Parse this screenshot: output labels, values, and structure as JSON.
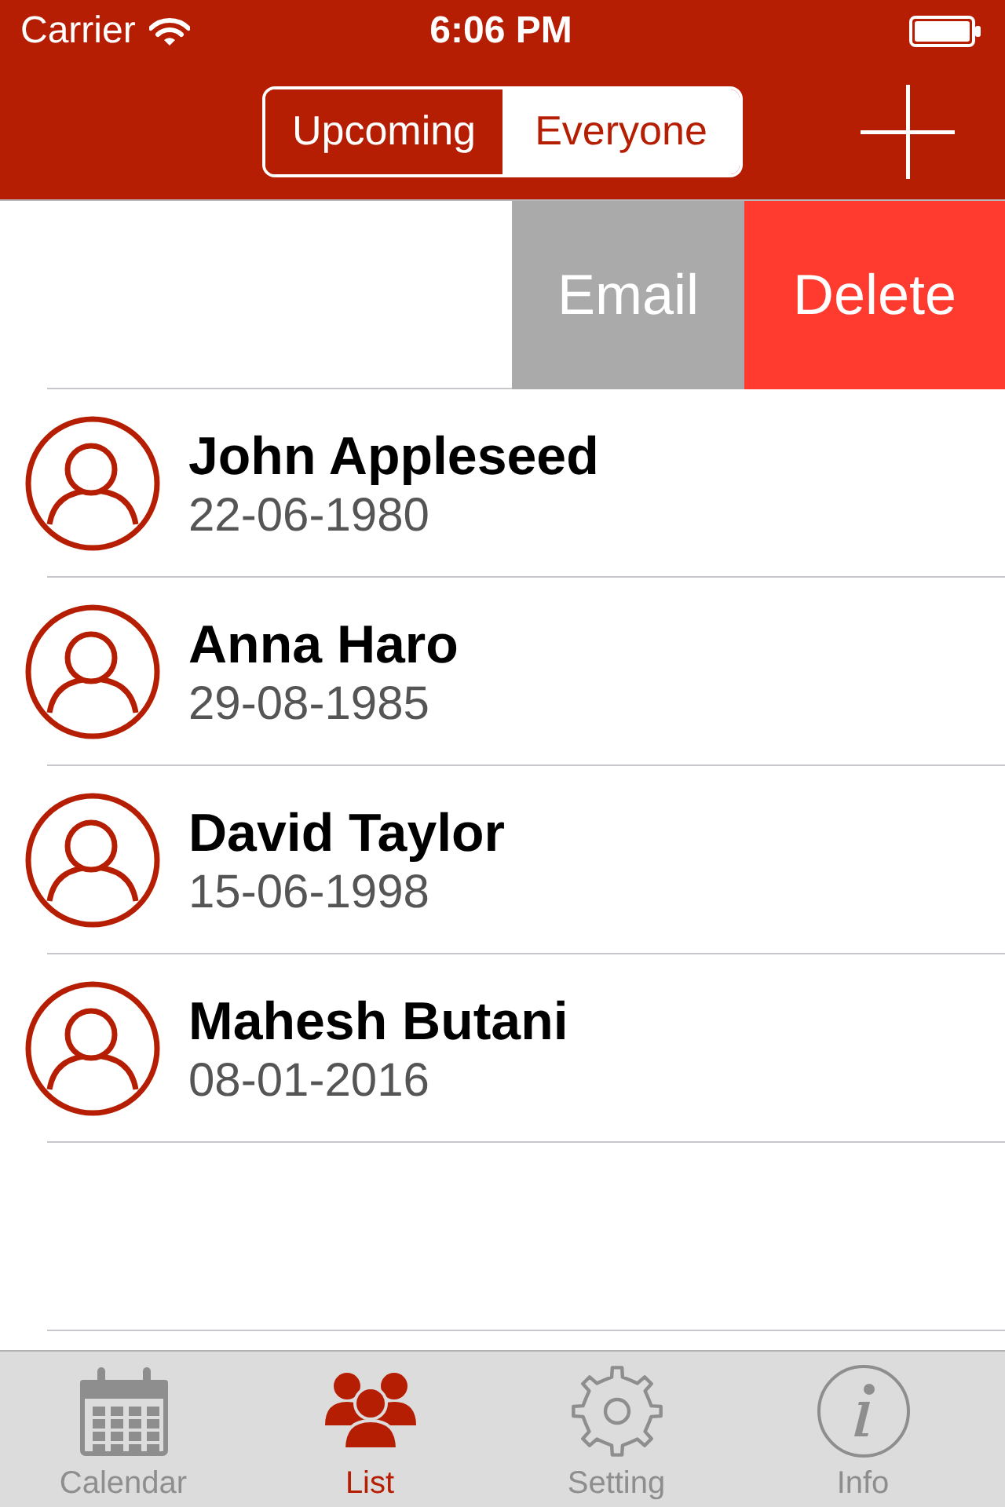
{
  "status_bar": {
    "carrier": "Carrier",
    "time": "6:06 PM"
  },
  "nav_bar": {
    "segments": [
      {
        "label": "Upcoming",
        "selected": true
      },
      {
        "label": "Everyone",
        "selected": false
      }
    ]
  },
  "swipe_actions": [
    {
      "label": "Email",
      "color": "#aaaaaa"
    },
    {
      "label": "Delete",
      "color": "#ff3b30"
    }
  ],
  "contacts": [
    {
      "name": "John Appleseed",
      "date": "22-06-1980"
    },
    {
      "name": "Anna Haro",
      "date": "29-08-1985"
    },
    {
      "name": "David Taylor",
      "date": "15-06-1998"
    },
    {
      "name": "Mahesh Butani",
      "date": "08-01-2016"
    }
  ],
  "tab_bar": [
    {
      "label": "Calendar",
      "selected": false
    },
    {
      "label": "List",
      "selected": true
    },
    {
      "label": "Setting",
      "selected": false
    },
    {
      "label": "Info",
      "selected": false
    }
  ]
}
